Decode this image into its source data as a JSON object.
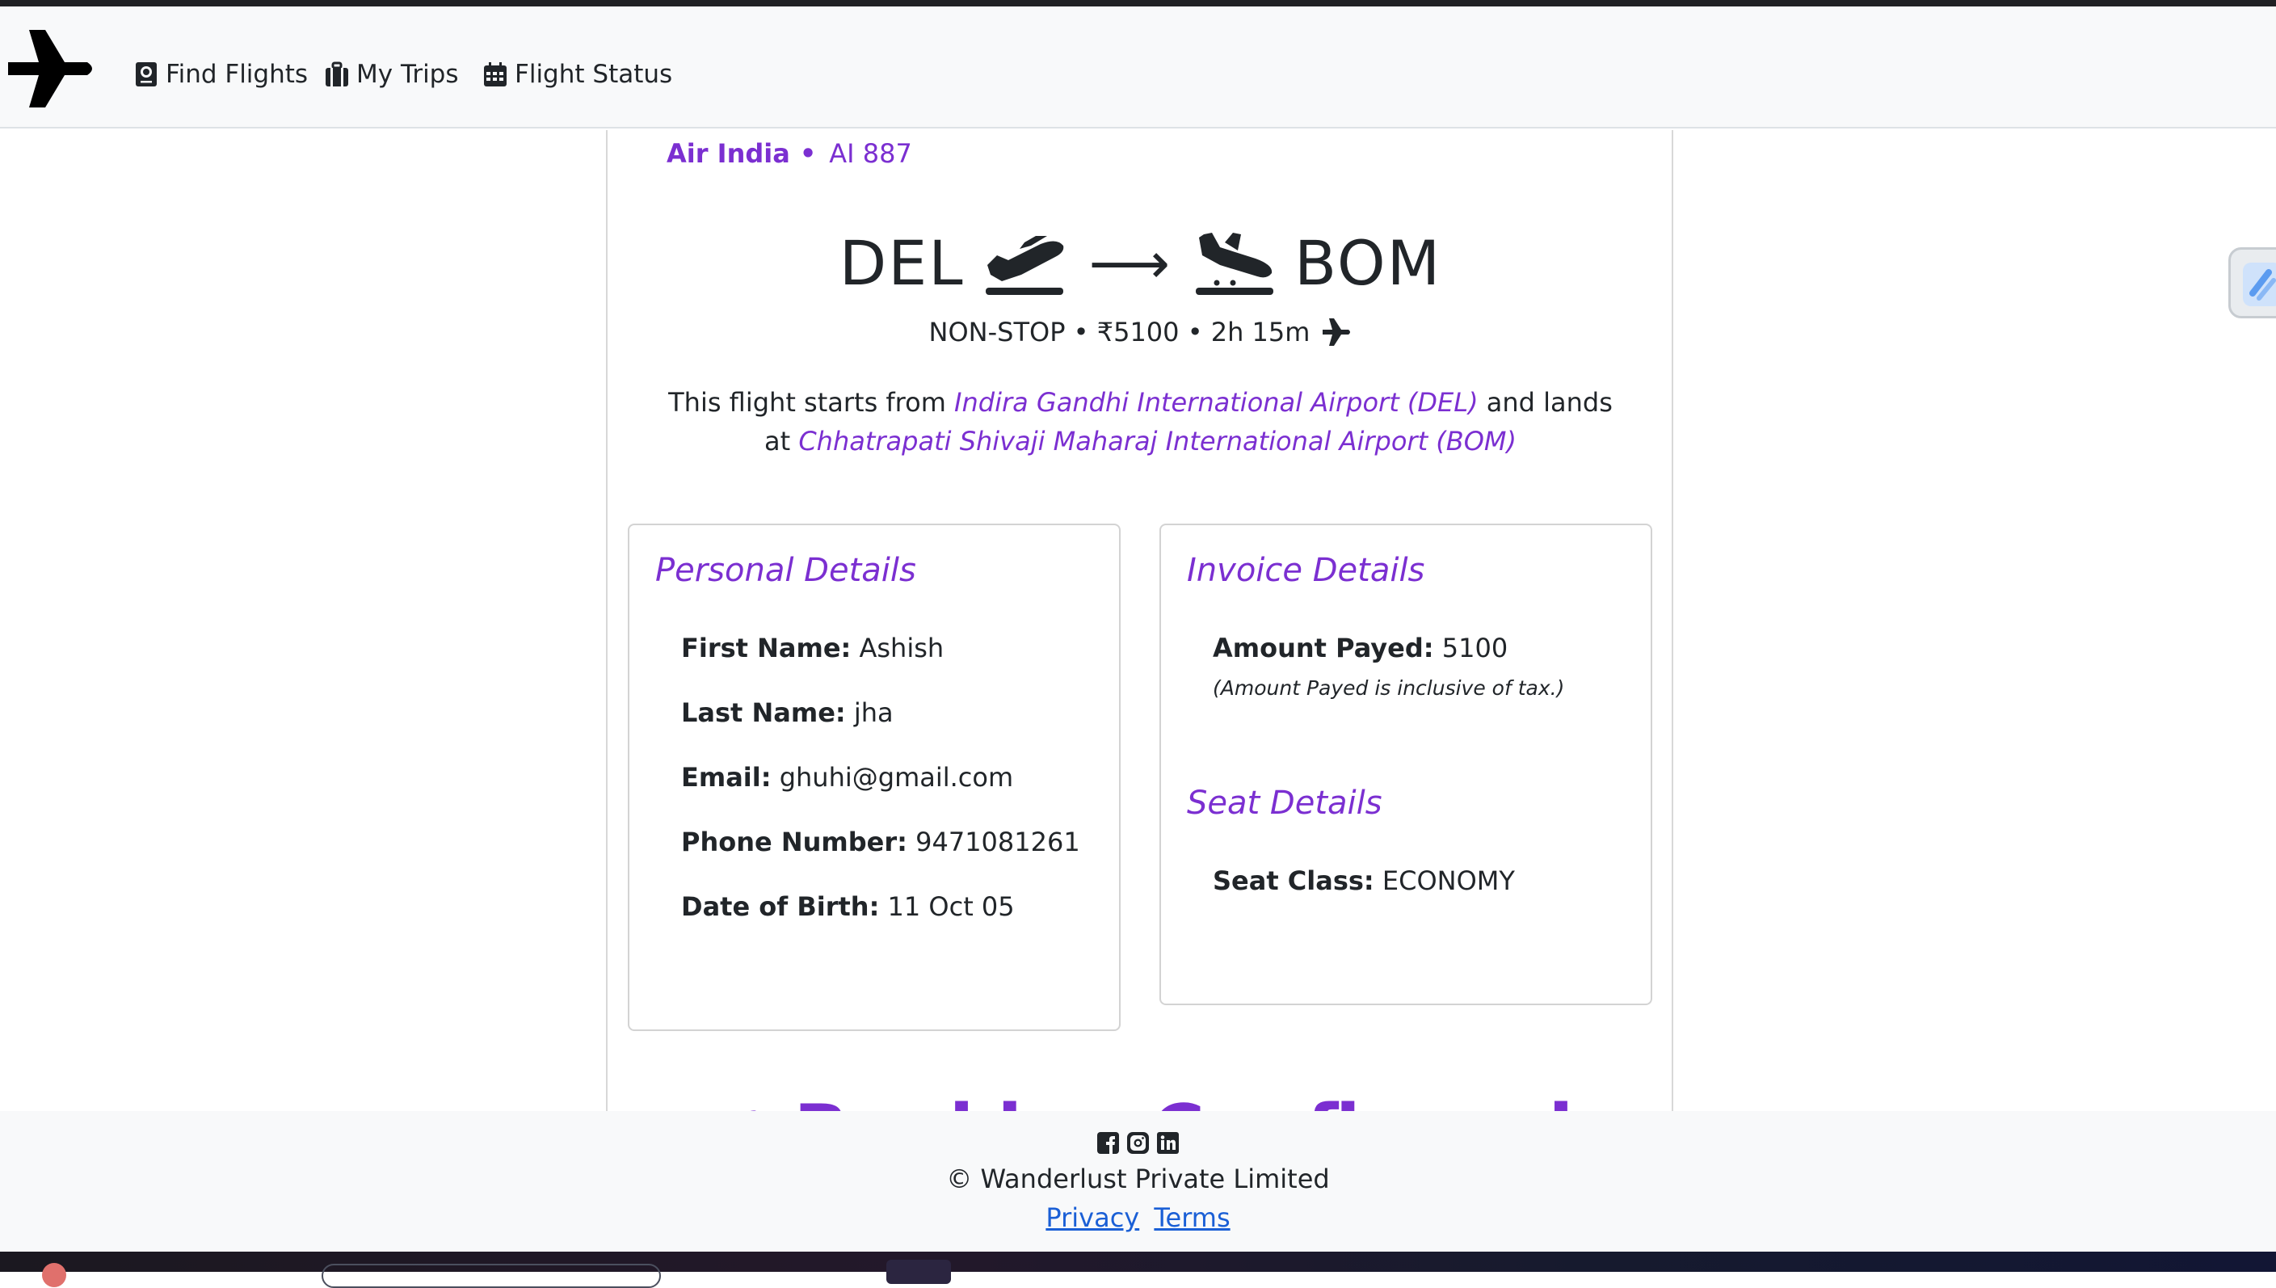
{
  "nav": {
    "find_flights": "Find Flights",
    "my_trips": "My Trips",
    "flight_status": "Flight Status"
  },
  "flight": {
    "airline": "Air India",
    "separator": "•",
    "number": "AI 887",
    "origin": "DEL",
    "destination": "BOM",
    "arrow": "⟶",
    "summary": "NON-STOP • ₹5100 • 2h 15m",
    "desc_prefix": "This flight starts from",
    "origin_airport": "Indira Gandhi International Airport (DEL)",
    "desc_middle": "and lands at",
    "destination_airport": "Chhatrapati Shivaji Maharaj International Airport (BOM)"
  },
  "personal": {
    "title": "Personal Details",
    "fields": [
      {
        "label": "First Name:",
        "value": "Ashish"
      },
      {
        "label": "Last Name:",
        "value": "jha"
      },
      {
        "label": "Email:",
        "value": "ghuhi@gmail.com"
      },
      {
        "label": "Phone Number:",
        "value": "9471081261"
      },
      {
        "label": "Date of Birth:",
        "value": "11 Oct 05"
      }
    ]
  },
  "invoice": {
    "title": "Invoice Details",
    "amount_label": "Amount Payed:",
    "amount_value": "5100",
    "note": "(Amount Payed is inclusive of tax.)"
  },
  "seat": {
    "title": "Seat Details",
    "class_label": "Seat Class:",
    "class_value": "ECONOMY"
  },
  "booking_heading": "✓ Booking Confirmed",
  "footer": {
    "copyright": "© Wanderlust Private Limited",
    "privacy": "Privacy",
    "terms": "Terms"
  },
  "icons": [
    "plane-logo-icon",
    "passport-icon",
    "suitcase-icon",
    "calendar-icon",
    "plane-departure-icon",
    "plane-arrival-icon",
    "plane-icon",
    "facebook-icon",
    "instagram-icon",
    "linkedin-icon"
  ],
  "colors": {
    "accent": "#7b2fd1",
    "link": "#1a5fd6",
    "navbar_bg": "#f8f9fa",
    "text": "#212529"
  }
}
